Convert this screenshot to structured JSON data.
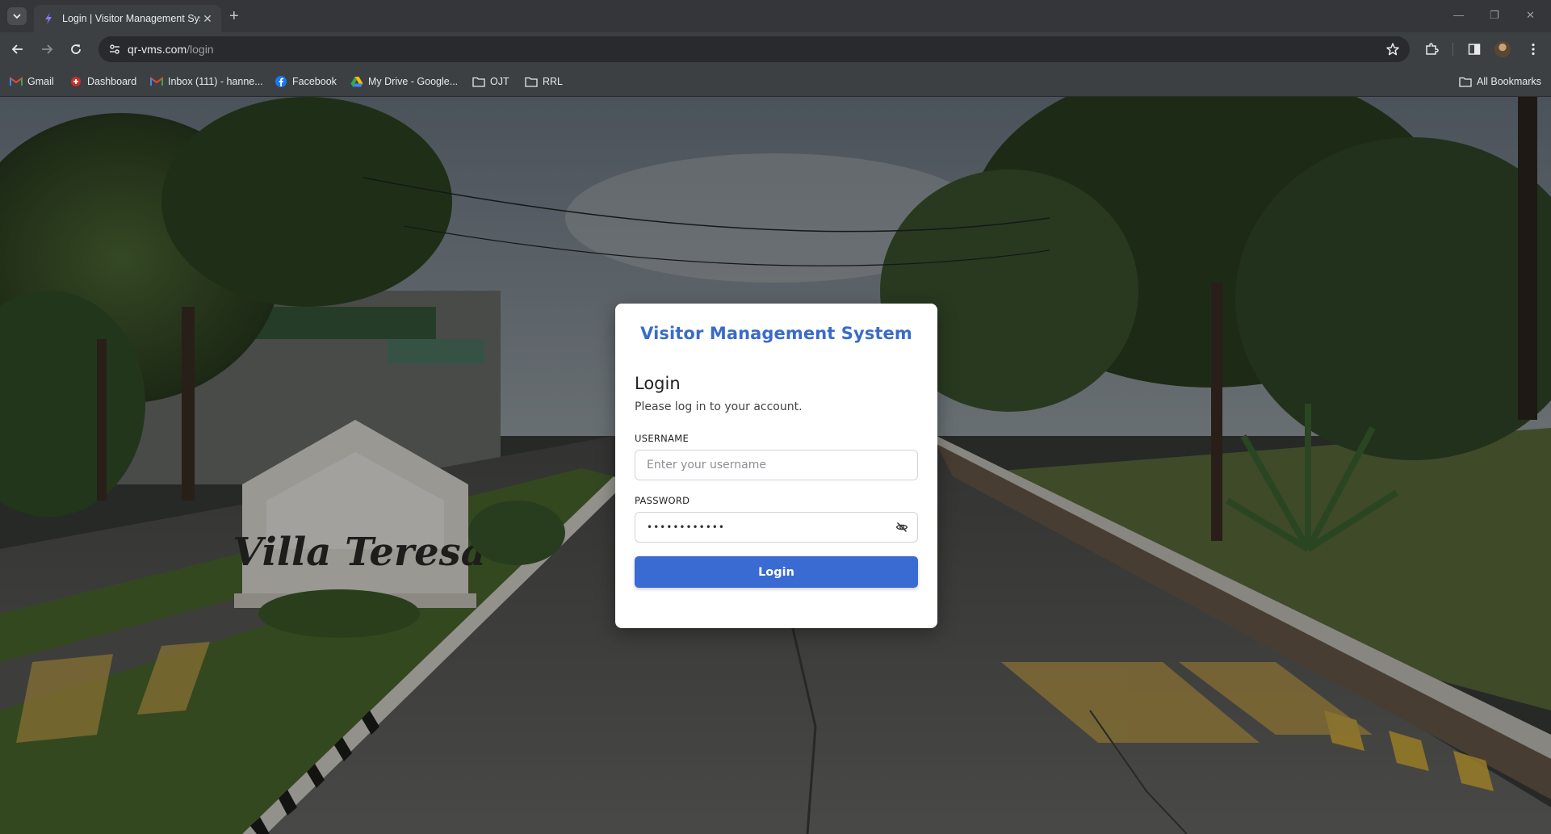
{
  "browser": {
    "tab": {
      "title": "Login | Visitor Management System",
      "close": "✕"
    },
    "new_tab": "+",
    "window_controls": {
      "minimize": "—",
      "restore": "❐",
      "close": "✕"
    },
    "address": {
      "host": "qr-vms.com",
      "path": "/login"
    },
    "bookmarks": [
      {
        "label": "Gmail",
        "icon": "gmail-icon"
      },
      {
        "label": "Dashboard",
        "icon": "dashboard-icon"
      },
      {
        "label": "Inbox (111) - hanne...",
        "icon": "gmail-icon"
      },
      {
        "label": "Facebook",
        "icon": "facebook-icon"
      },
      {
        "label": "My Drive - Google...",
        "icon": "google-drive-icon"
      },
      {
        "label": "OJT",
        "icon": "folder-icon"
      },
      {
        "label": "RRL",
        "icon": "folder-icon"
      }
    ],
    "all_bookmarks": "All Bookmarks"
  },
  "page": {
    "sign_text": "Villa Teresa",
    "brand": "Visitor Management System",
    "heading": "Login",
    "subheading": "Please log in to your account.",
    "username": {
      "label": "USERNAME",
      "placeholder": "Enter your username",
      "value": ""
    },
    "password": {
      "label": "PASSWORD",
      "value": "••••••••••••"
    },
    "submit_label": "Login"
  }
}
